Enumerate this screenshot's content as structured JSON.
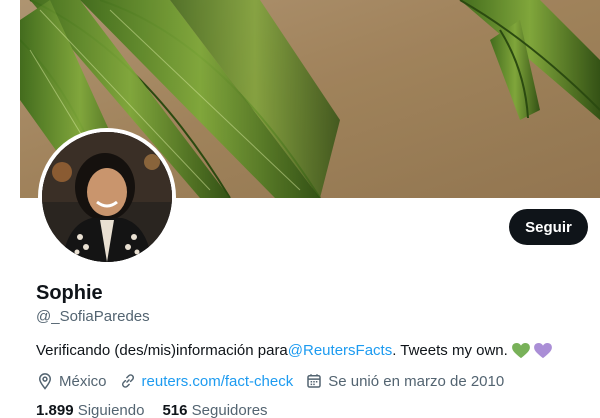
{
  "profile": {
    "name": "Sophie",
    "handle": "@_SofiaParedes",
    "follow_label": "Seguir",
    "bio": {
      "prefix": "Verificando (des/mis)información para ",
      "mention": "@ReutersFacts",
      "suffix": ". Tweets my own.",
      "hearts": [
        "green-heart",
        "purple-heart"
      ]
    },
    "location": "México",
    "website": "reuters.com/fact-check",
    "joined": "Se unió en marzo de 2010",
    "following_count": "1.899",
    "following_label": "Siguiendo",
    "followers_count": "516",
    "followers_label": "Seguidores"
  },
  "colors": {
    "link": "#1d9bf0",
    "secondary_text": "#536471",
    "primary_text": "#0f1419",
    "button_bg": "#0f1419",
    "heart_green": "#78b159",
    "heart_purple": "#aa8ed6"
  },
  "icons": {
    "location": "location-pin-icon",
    "website": "link-icon",
    "joined": "calendar-icon"
  }
}
